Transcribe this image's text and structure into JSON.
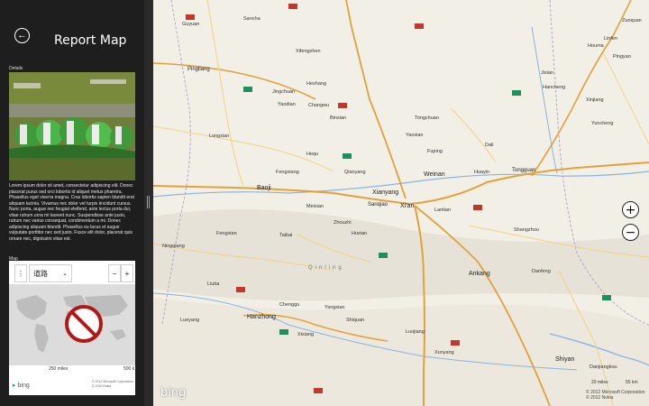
{
  "app": {
    "title": "Report Map",
    "details_label": "Details",
    "description": "Lorem ipsum dolor sit amet, consectetur adipiscing elit. Donec placerat purus sed orci lobortis id aliquet metus pharetra. Phasellus eget viverra magna. Cras lobortis sapien blandit erat aliquam lacinia. Vivamus nec dolor vel turpis tincidunt cursus. Nunc porta, augue nec feugiat eleifend, ante lectus porta dui, vitae rutrum urna mi laoreet nunc. Suspendisse ante justo, rutrum nec varius consequat, condimentum a mi. Donec adipiscing aliquam blandit. Phasellus eu lacus et augue vulputate porttitor nec sed justo. Fusce elit dolor, placerat quis ornare nec, dignissim vitae est.",
    "map_label": "Map"
  },
  "mini_map": {
    "mode_label": "道路",
    "zoom_out": "−",
    "zoom_in": "+",
    "scale_miles": "250 miles",
    "scale_km": "500 k",
    "brand": "bing",
    "copyright_lines": [
      "© 2012 Microsoft Corporation",
      "© 2010 Nokia"
    ]
  },
  "main_map": {
    "zoom_in": "+",
    "zoom_out": "−",
    "brand": "bing",
    "scale_miles": "20 miles",
    "scale_km": "55 km",
    "copyright_lines": [
      "© 2012 Microsoft Corporation",
      "© 2012 Nokia"
    ],
    "places": [
      {
        "name": "Sancha"
      },
      {
        "name": "Guyuan"
      },
      {
        "name": "Pingliang"
      },
      {
        "name": "Xifengzhen"
      },
      {
        "name": "Heshang"
      },
      {
        "name": "Jingchuan"
      },
      {
        "name": "Yaodian"
      },
      {
        "name": "Changwu"
      },
      {
        "name": "Binxian"
      },
      {
        "name": "Longxian"
      },
      {
        "name": "Qianyang"
      },
      {
        "name": "Fengxiang"
      },
      {
        "name": "Baoji"
      },
      {
        "name": "Meixian"
      },
      {
        "name": "Xianyang"
      },
      {
        "name": "Xi'an"
      },
      {
        "name": "Sanqiao"
      },
      {
        "name": "Weinan"
      },
      {
        "name": "Huayin"
      },
      {
        "name": "Tongguan"
      },
      {
        "name": "Tongchuan"
      },
      {
        "name": "Yaoxian"
      },
      {
        "name": "Fuping"
      },
      {
        "name": "Dali"
      },
      {
        "name": "Hanzhong"
      },
      {
        "name": "Ankang"
      },
      {
        "name": "Shiquan"
      },
      {
        "name": "Xixiang"
      },
      {
        "name": "Chenggu"
      },
      {
        "name": "Lueyang"
      },
      {
        "name": "Xunyang"
      },
      {
        "name": "Shangzhou"
      },
      {
        "name": "Danfeng"
      },
      {
        "name": "Lantian"
      },
      {
        "name": "Yuncheng"
      },
      {
        "name": "Linfen"
      },
      {
        "name": "Houma"
      },
      {
        "name": "Jixian"
      },
      {
        "name": "Hancheng"
      },
      {
        "name": "Xinjiang"
      },
      {
        "name": "Luojiang"
      },
      {
        "name": "Shiyan"
      },
      {
        "name": "Danjiangkou"
      },
      {
        "name": "Ningqiang"
      },
      {
        "name": "Fengxian"
      },
      {
        "name": "Taibai"
      },
      {
        "name": "Zhouzhi"
      },
      {
        "name": "Huxian"
      },
      {
        "name": "Qinling"
      },
      {
        "name": "Liuba"
      },
      {
        "name": "Yangxian"
      },
      {
        "name": "Hequ"
      },
      {
        "name": "Pingyao"
      },
      {
        "name": "Zuoquan"
      }
    ]
  },
  "colors": {
    "sidebar_bg": "#1e1e1e",
    "map_bg": "#f2efe7",
    "road_major": "#e2a13a",
    "road_minor": "#f3d486",
    "river": "#8ab4e0",
    "shield_red": "#c0392b",
    "shield_green": "#1f8f5b"
  }
}
